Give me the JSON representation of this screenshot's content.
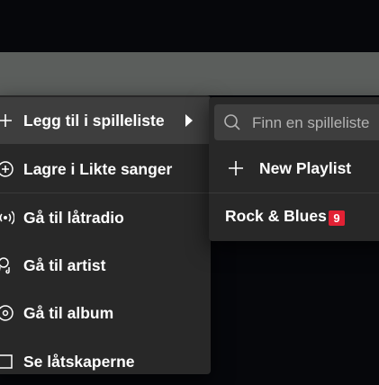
{
  "context_menu": {
    "items": [
      {
        "label": "Legg til i spilleliste",
        "icon": "plus-icon"
      },
      {
        "label": "Lagre i Likte sanger",
        "icon": "circle-plus-icon"
      },
      {
        "label": "Gå til låtradio",
        "icon": "radio-icon"
      },
      {
        "label": "Gå til artist",
        "icon": "artist-icon"
      },
      {
        "label": "Gå til album",
        "icon": "album-icon"
      },
      {
        "label": "Se låtskaperne",
        "icon": "credits-icon"
      }
    ]
  },
  "submenu": {
    "search_placeholder": "Finn en spilleliste",
    "new_playlist_label": "New Playlist",
    "playlists": [
      {
        "name": "Rock & Blues",
        "count": "9"
      }
    ]
  },
  "colors": {
    "menu_bg": "#282828",
    "hover_bg": "#3e3e3e",
    "badge": "#e22134",
    "band": "#5b5e5c"
  }
}
